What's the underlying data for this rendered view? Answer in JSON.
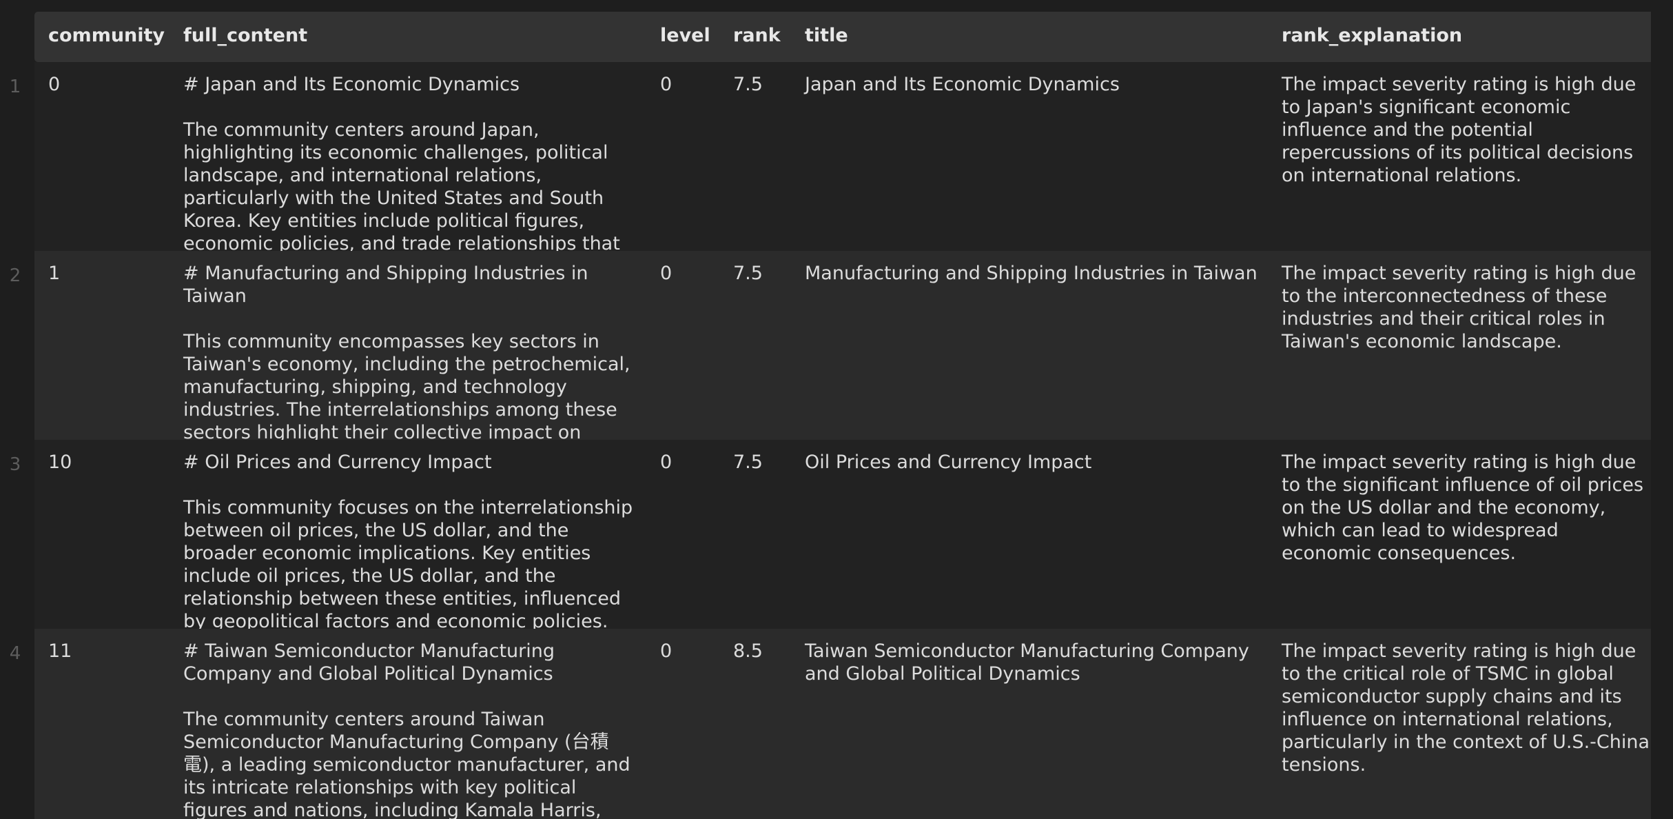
{
  "columns": [
    "community",
    "full_content",
    "level",
    "rank",
    "title",
    "rank_explanation"
  ],
  "rows": [
    {
      "row_number": "1",
      "community": "0",
      "heading": "# Japan and Its Economic Dynamics",
      "body": "The community centers around Japan, highlighting its economic challenges, political landscape, and international relations, particularly with the United States and South Korea. Key entities include political figures, economic policies, and trade relationships that shape",
      "level": "0",
      "rank": "7.5",
      "title": "Japan and Its Economic Dynamics",
      "rank_explanation": "The impact severity rating is high due to Japan's significant economic influence and the potential repercussions of its political decisions on international relations."
    },
    {
      "row_number": "2",
      "community": "1",
      "heading": "# Manufacturing and Shipping Industries in Taiwan",
      "body": "This community encompasses key sectors in Taiwan's economy, including the petrochemical, manufacturing, shipping, and technology industries. The interrelationships among these sectors highlight their collective impact on economic growth and trade, with significant",
      "level": "0",
      "rank": "7.5",
      "title": "Manufacturing and Shipping Industries in Taiwan",
      "rank_explanation": "The impact severity rating is high due to the interconnectedness of these industries and their critical roles in Taiwan's economic landscape."
    },
    {
      "row_number": "3",
      "community": "10",
      "heading": "# Oil Prices and Currency Impact",
      "body": "This community focuses on the interrelationship between oil prices, the US dollar, and the broader economic implications. Key entities include oil prices, the US dollar, and the relationship between these entities, influenced by geopolitical factors and economic policies.",
      "level": "0",
      "rank": "7.5",
      "title": "Oil Prices and Currency Impact",
      "rank_explanation": "The impact severity rating is high due to the significant influence of oil prices on the US dollar and the economy, which can lead to widespread economic consequences."
    },
    {
      "row_number": "4",
      "community": "11",
      "heading": "# Taiwan Semiconductor Manufacturing Company and Global Political Dynamics",
      "body": "The community centers around Taiwan Semiconductor Manufacturing Company (台積電), a leading semiconductor manufacturer, and its intricate relationships with key political figures and nations, including Kamala Harris, Donald Trump,",
      "level": "0",
      "rank": "8.5",
      "title": "Taiwan Semiconductor Manufacturing Company and Global Political Dynamics",
      "rank_explanation": "The impact severity rating is high due to the critical role of TSMC in global semiconductor supply chains and its influence on international relations, particularly in the context of U.S.-China tensions."
    }
  ]
}
